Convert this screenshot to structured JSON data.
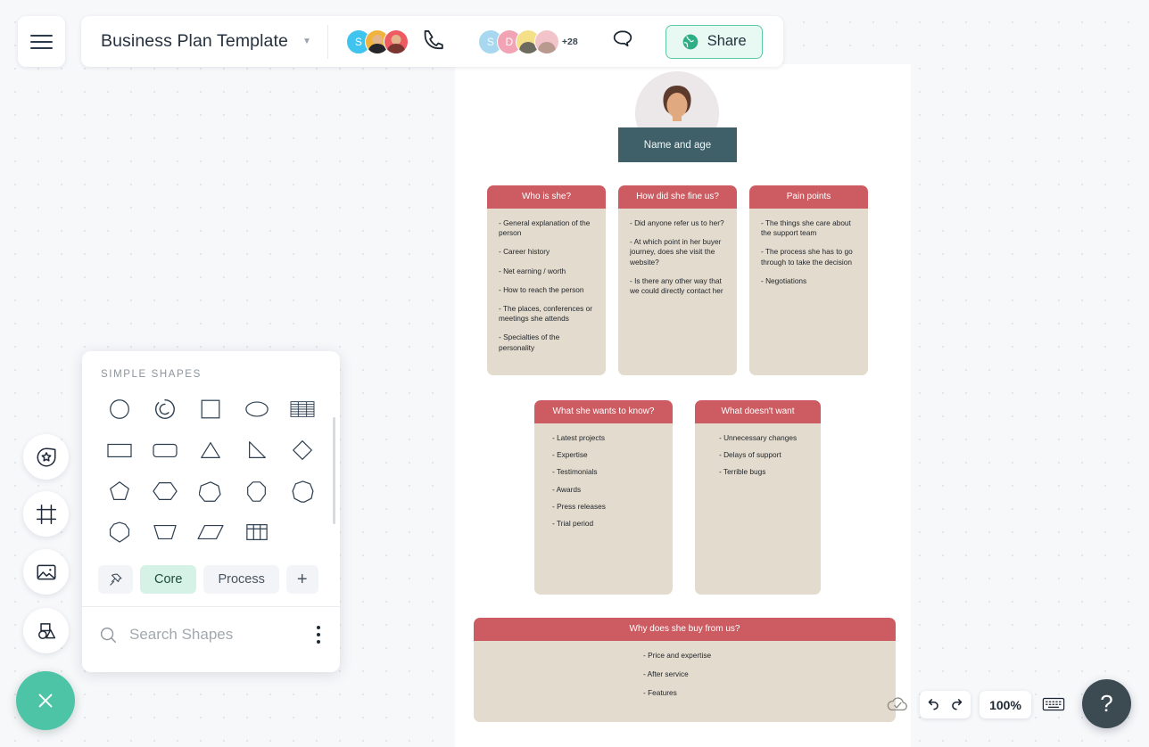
{
  "app": {
    "document_title": "Business Plan Template",
    "title_caret": "▼",
    "menu_icon": "hamburger-menu-icon"
  },
  "collaborators": {
    "active": [
      {
        "initial": "S",
        "color": "#3fc3ef",
        "type": "initial"
      },
      {
        "initial": "",
        "color": "#f0b43c",
        "type": "photo"
      },
      {
        "initial": "",
        "color": "#ef5b62",
        "type": "photo"
      }
    ],
    "others": [
      {
        "initial": "S",
        "color": "#a8d8ef",
        "type": "initial"
      },
      {
        "initial": "D",
        "color": "#f2a3b4",
        "type": "initial"
      },
      {
        "initial": "",
        "color": "#f5e08a",
        "type": "photo"
      },
      {
        "initial": "",
        "color": "#f2c3c9",
        "type": "photo"
      }
    ],
    "overflow_label": "+28",
    "call_icon": "phone-icon",
    "chat_icon": "chat-bubble-icon"
  },
  "share": {
    "label": "Share",
    "icon": "globe-icon",
    "accent": "#5ec9a8",
    "background": "#e8f8f2"
  },
  "left_rail": {
    "items": [
      {
        "name": "shapes-tool",
        "icon": "star-circle-icon"
      },
      {
        "name": "frame-tool",
        "icon": "frame-icon"
      },
      {
        "name": "image-tool",
        "icon": "image-icon"
      },
      {
        "name": "objects-tool",
        "icon": "shapes-combo-icon"
      }
    ],
    "close_button": {
      "icon": "close-icon",
      "color": "#4ec4a7"
    }
  },
  "shapes_panel": {
    "header": "SIMPLE SHAPES",
    "shapes": [
      "circle",
      "arc",
      "square",
      "ellipse",
      "grid-table",
      "rectangle",
      "rounded-rectangle",
      "triangle",
      "right-triangle",
      "diamond",
      "pentagon",
      "hexagon",
      "heptagon",
      "octagon",
      "nonagon",
      "decagon",
      "trapezoid",
      "parallelogram",
      "table"
    ],
    "tabs": [
      {
        "label": "",
        "name": "pin-tab",
        "icon": "pin-icon",
        "active": false
      },
      {
        "label": "Core",
        "name": "core-tab",
        "active": true
      },
      {
        "label": "Process",
        "name": "process-tab",
        "active": false
      },
      {
        "label": "+",
        "name": "add-tab",
        "active": false
      }
    ],
    "search_placeholder": "Search Shapes",
    "search_value": "",
    "search_icon": "search-icon",
    "more_icon": "more-vertical-icon"
  },
  "persona": {
    "avatar_label": "user-avatar-illustration",
    "name_bar": "Name and age",
    "cards": [
      {
        "title": "Who is she?",
        "items": [
          "- General explanation of the person",
          "- Career history",
          "- Net earning / worth",
          "- How to reach the person",
          "- The places, conferences or meetings she attends",
          "- Specialties of the personality"
        ]
      },
      {
        "title": "How did she fine us?",
        "items": [
          "- Did anyone refer us to her?",
          "- At which point in her buyer journey, does she visit the website?",
          "- Is there any other way that we could directly contact her"
        ]
      },
      {
        "title": "Pain points",
        "items": [
          "- The things she care about the support team",
          "- The process she has to go through to take the decision",
          "- Negotiations"
        ]
      },
      {
        "title": "What she wants to know?",
        "items": [
          "- Latest projects",
          "- Expertise",
          "- Testimonials",
          "- Awards",
          "- Press releases",
          "- Trial period"
        ]
      },
      {
        "title": "What doesn't want",
        "items": [
          "- Unnecessary changes",
          "- Delays of support",
          "- Terrible bugs"
        ]
      },
      {
        "title": "Why does she buy from us?",
        "items": [
          "- Price and expertise",
          "- After service",
          "- Features"
        ]
      }
    ],
    "header_color": "#cd5c62",
    "body_color": "#e3dbcd"
  },
  "bottom_toolbar": {
    "save_status_icon": "cloud-check-icon",
    "undo_icon": "undo-icon",
    "redo_icon": "redo-icon",
    "zoom_level": "100%",
    "keyboard_icon": "keyboard-icon",
    "help_label": "?"
  }
}
